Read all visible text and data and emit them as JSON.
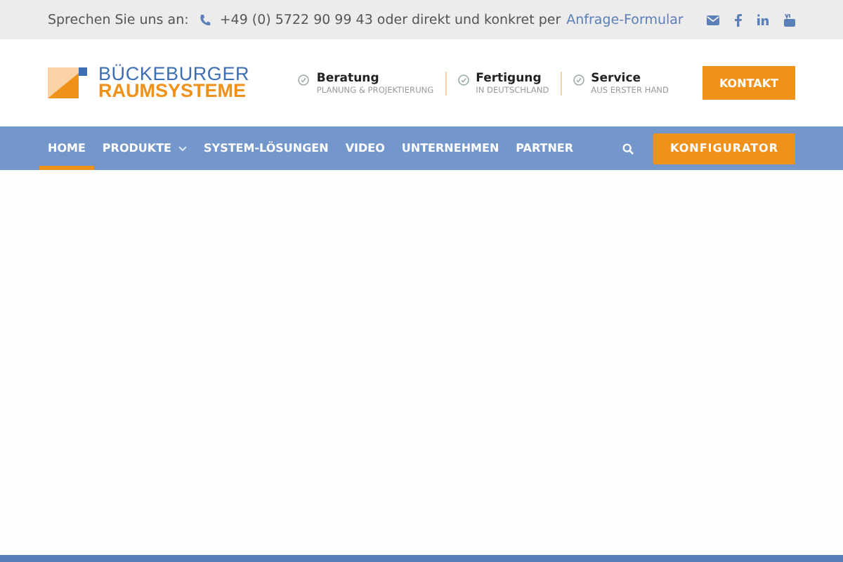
{
  "top_bar": {
    "label": "Sprechen Sie uns an:",
    "phone": "+49 (0) 5722 90 99 43 oder direkt und konkret per",
    "link": "Anfrage-Formular"
  },
  "logo": {
    "line_1": "BÜCKEBURGER",
    "line_2": "RAUMSYSTEME"
  },
  "features": [
    {
      "title": "Beratung",
      "subtitle": "PLANUNG & PROJEKTIERUNG"
    },
    {
      "title": "Fertigung",
      "subtitle": "IN DEUTSCHLAND"
    },
    {
      "title": "Service",
      "subtitle": "AUS ERSTER HAND"
    }
  ],
  "contact_button": "KONTAKT",
  "nav": [
    {
      "label": "HOME",
      "selected": true,
      "dropdown": false
    },
    {
      "label": "PRODUKTE",
      "selected": false,
      "dropdown": true
    },
    {
      "label": "SYSTEM-LÖSUNGEN",
      "selected": false,
      "dropdown": false
    },
    {
      "label": "VIDEO",
      "selected": false,
      "dropdown": false
    },
    {
      "label": "UNTERNEHMEN",
      "selected": false,
      "dropdown": false
    },
    {
      "label": "PARTNER",
      "selected": false,
      "dropdown": false
    }
  ],
  "configurator_button": "KONFIGURATOR"
}
